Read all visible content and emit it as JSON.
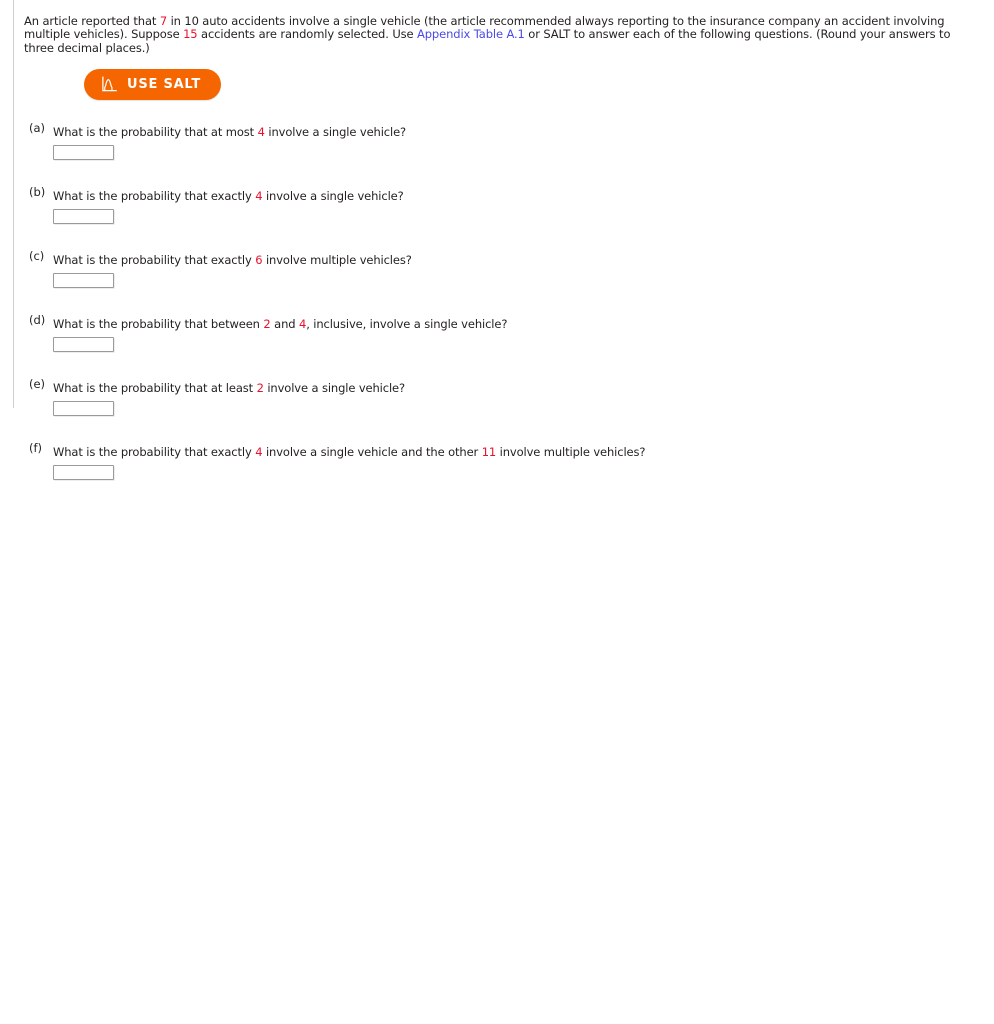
{
  "colors": {
    "accent_orange": "#f56600",
    "number_red": "#e8112d",
    "link_blue": "#4a4ae8",
    "text": "#231f20",
    "rule_gray": "#cfcfcf",
    "input_border": "#9a9a9a"
  },
  "stem": {
    "part1": "An article reported that ",
    "n1": "7",
    "part2": " in 10 auto accidents involve a single vehicle (the article recommended always reporting to the insurance company an accident involving multiple vehicles). Suppose ",
    "n2": "15",
    "part3": " accidents are randomly selected. Use ",
    "link": "Appendix Table A.1",
    "part4": " or SALT to answer each of the following questions. (Round your answers to three decimal places.)"
  },
  "salt_button": {
    "label": "USE SALT",
    "icon": "normal-distribution-curve-icon"
  },
  "parts": [
    {
      "label": "(a)",
      "segments": [
        {
          "text": "What is the probability that at most ",
          "red": false
        },
        {
          "text": "4",
          "red": true
        },
        {
          "text": " involve a single vehicle?",
          "red": false
        }
      ],
      "answer_value": "",
      "answer_placeholder": ""
    },
    {
      "label": "(b)",
      "segments": [
        {
          "text": "What is the probability that exactly ",
          "red": false
        },
        {
          "text": "4",
          "red": true
        },
        {
          "text": " involve a single vehicle?",
          "red": false
        }
      ],
      "answer_value": "",
      "answer_placeholder": ""
    },
    {
      "label": "(c)",
      "segments": [
        {
          "text": "What is the probability that exactly ",
          "red": false
        },
        {
          "text": "6",
          "red": true
        },
        {
          "text": " involve multiple vehicles?",
          "red": false
        }
      ],
      "answer_value": "",
      "answer_placeholder": ""
    },
    {
      "label": "(d)",
      "segments": [
        {
          "text": "What is the probability that between ",
          "red": false
        },
        {
          "text": "2",
          "red": true
        },
        {
          "text": " and ",
          "red": false
        },
        {
          "text": "4",
          "red": true
        },
        {
          "text": ", inclusive, involve a single vehicle?",
          "red": false
        }
      ],
      "answer_value": "",
      "answer_placeholder": ""
    },
    {
      "label": "(e)",
      "segments": [
        {
          "text": "What is the probability that at least ",
          "red": false
        },
        {
          "text": "2",
          "red": true
        },
        {
          "text": " involve a single vehicle?",
          "red": false
        }
      ],
      "answer_value": "",
      "answer_placeholder": ""
    },
    {
      "label": "(f)",
      "segments": [
        {
          "text": "What is the probability that exactly ",
          "red": false
        },
        {
          "text": "4",
          "red": true
        },
        {
          "text": " involve a single vehicle and the other ",
          "red": false
        },
        {
          "text": "11",
          "red": true
        },
        {
          "text": " involve multiple vehicles?",
          "red": false
        }
      ],
      "answer_value": "",
      "answer_placeholder": ""
    }
  ]
}
